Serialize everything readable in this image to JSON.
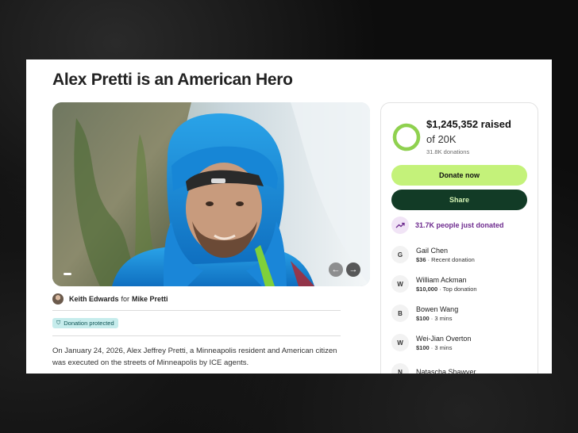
{
  "campaign": {
    "title": "Alex Pretti is an American Hero",
    "organizer": {
      "name": "Keith Edwards",
      "for_label": "for",
      "beneficiary": "Mike Pretti"
    },
    "badge": "Donation protected",
    "description": "On January 24, 2026, Alex Jeffrey Pretti, a Minneapolis resident and American citizen was executed on the streets of Minneapolis by ICE agents.",
    "gallery": {
      "prev_icon": "←",
      "next_icon": "→"
    }
  },
  "sidebar": {
    "raised": "$1,245,352 raised",
    "goal": "of 20K",
    "donations_count": "31.8K donations",
    "progress_fraction": 1.0,
    "donate_button": "Donate now",
    "share_button": "Share",
    "trend_text": "31.7K people just donated",
    "donors": [
      {
        "initial": "G",
        "name": "Gail Chen",
        "amount": "$36",
        "note": " · Recent donation"
      },
      {
        "initial": "W",
        "name": "William Ackman",
        "amount": "$10,000",
        "note": " · Top donation"
      },
      {
        "initial": "B",
        "name": "Bowen Wang",
        "amount": "$100",
        "note": " · 3 mins"
      },
      {
        "initial": "W",
        "name": "Wei-Jian Overton",
        "amount": "$100",
        "note": " · 3 mins"
      },
      {
        "initial": "N",
        "name": "Natascha Shawver",
        "amount": "",
        "note": ""
      }
    ]
  },
  "colors": {
    "donate_bg": "#c4f27a",
    "share_bg": "#123b26",
    "progress_ring": "#8fd14f",
    "badge_bg": "#c6ecec",
    "trend_text": "#6d2a8e"
  }
}
